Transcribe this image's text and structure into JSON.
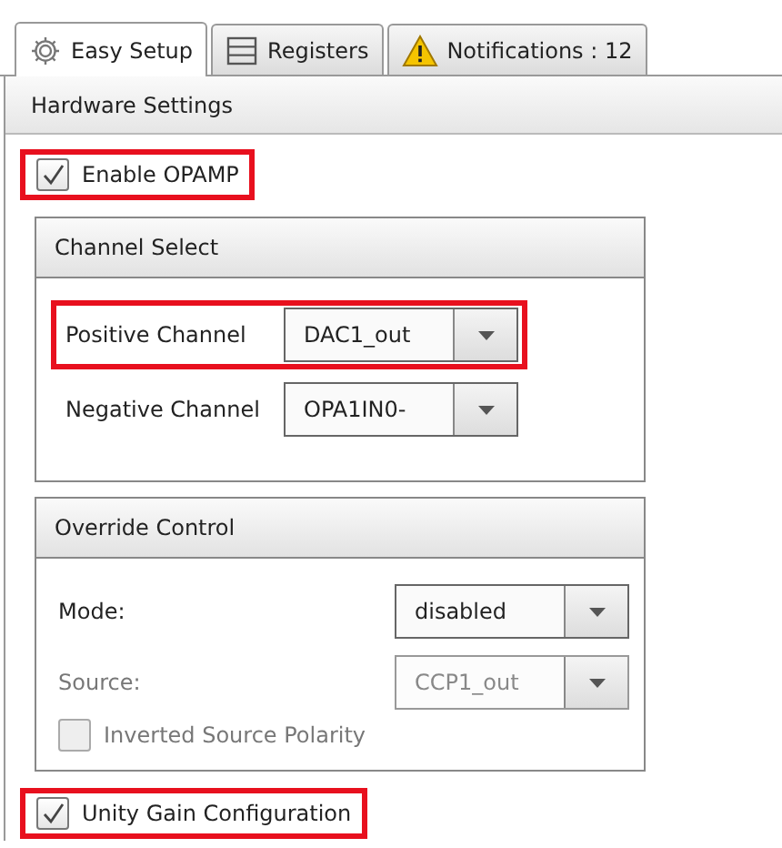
{
  "tabs": [
    {
      "label": "Easy Setup",
      "kind": "gear",
      "selected": true
    },
    {
      "label": "Registers",
      "kind": "list",
      "selected": false
    },
    {
      "label": "Notifications : 12",
      "kind": "warning",
      "selected": false
    }
  ],
  "section": {
    "title": "Hardware Settings"
  },
  "enable_opamp": {
    "label": "Enable OPAMP",
    "checked": true,
    "highlighted": true
  },
  "channel_select": {
    "title": "Channel Select",
    "rows": [
      {
        "label": "Positive Channel",
        "value": "DAC1_out",
        "disabled": false,
        "highlighted": true
      },
      {
        "label": "Negative Channel",
        "value": "OPA1IN0-",
        "disabled": false,
        "highlighted": false
      }
    ]
  },
  "override_control": {
    "title": "Override Control",
    "rows": [
      {
        "kind": "dropdown",
        "label": "Mode:",
        "value": "disabled",
        "disabled": false
      },
      {
        "kind": "dropdown",
        "label": "Source:",
        "value": "CCP1_out",
        "disabled": true
      },
      {
        "kind": "checkbox",
        "label": "Inverted Source Polarity",
        "checked": false,
        "disabled": true
      }
    ]
  },
  "unity_gain": {
    "label": "Unity Gain Configuration",
    "checked": true,
    "highlighted": true
  }
}
